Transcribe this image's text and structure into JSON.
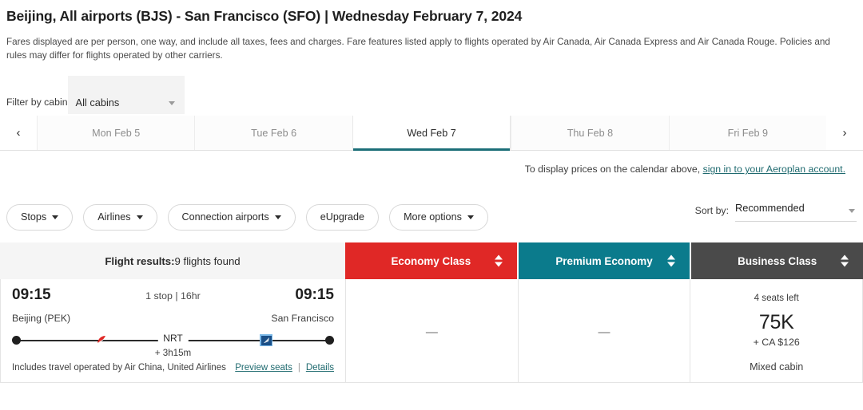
{
  "header": {
    "route_title": "Beijing, All airports (BJS) - San Francisco (SFO)",
    "title_separator": "|",
    "date_title": "Wednesday February 7, 2024",
    "disclaimer": "Fares displayed are per person, one way, and include all taxes, fees and charges. Fare features listed apply to flights operated by Air Canada, Air Canada Express and Air Canada Rouge. Policies and rules may differ for flights operated by other carriers."
  },
  "cabin_filter": {
    "label": "Filter by cabin",
    "selected": "All cabins",
    "caret_icon": "chevron-down-icon"
  },
  "date_strip": {
    "prev_icon": "‹",
    "next_icon": "›",
    "tabs": [
      {
        "label": "Mon Feb 5",
        "active": false
      },
      {
        "label": "Tue Feb 6",
        "active": false
      },
      {
        "label": "Wed Feb 7",
        "active": true
      },
      {
        "label": "Thu Feb 8",
        "active": false
      },
      {
        "label": "Fri Feb 9",
        "active": false
      }
    ],
    "active_underline_color": "#1c6e78"
  },
  "signin_notice": {
    "text": "To display prices on the calendar above,",
    "link": "sign in to your Aeroplan account.",
    "link_color": "#1f6a6f"
  },
  "filters": {
    "pills": [
      {
        "label": "Stops",
        "has_caret": true
      },
      {
        "label": "Airlines",
        "has_caret": true
      },
      {
        "label": "Connection airports",
        "has_caret": true
      },
      {
        "label": "eUpgrade",
        "has_caret": false
      },
      {
        "label": "More options",
        "has_caret": true
      }
    ],
    "sort": {
      "label": "Sort by:",
      "selected": "Recommended",
      "caret_icon": "chevron-down-icon"
    }
  },
  "results_bar": {
    "results_label": "Flight results:",
    "results_count": "9 flights found",
    "classes": [
      {
        "label": "Economy Class",
        "color": "#e02826",
        "sort_icon": "sort-arrows-icon"
      },
      {
        "label": "Premium Economy",
        "color": "#0b7b8c",
        "sort_icon": "sort-arrows-icon"
      },
      {
        "label": "Business Class",
        "color": "#4a4a4a",
        "sort_icon": "sort-arrows-icon"
      }
    ]
  },
  "flight": {
    "depart_time": "09:15",
    "arrive_time": "09:15",
    "stops_duration": "1 stop | 16hr",
    "origin_city": "Beijing (PEK)",
    "destination_city": "San Francisco",
    "connection_code": "NRT",
    "layover": "+ 3h15m",
    "operated_by": "Includes travel operated by Air China, United Airlines",
    "preview_seats_link": "Preview seats",
    "link_divider": "|",
    "details_link": "Details",
    "carrier_icon_1": "air-china-icon",
    "carrier_icon_2": "united-airlines-icon",
    "prices": {
      "economy": {
        "available": false,
        "unavailable_mark": "—"
      },
      "premium": {
        "available": false,
        "unavailable_mark": "—"
      },
      "business": {
        "available": true,
        "seats_left": "4 seats left",
        "points": "75K",
        "surcharge": "+ CA $126",
        "cabin_note": "Mixed cabin"
      }
    }
  }
}
